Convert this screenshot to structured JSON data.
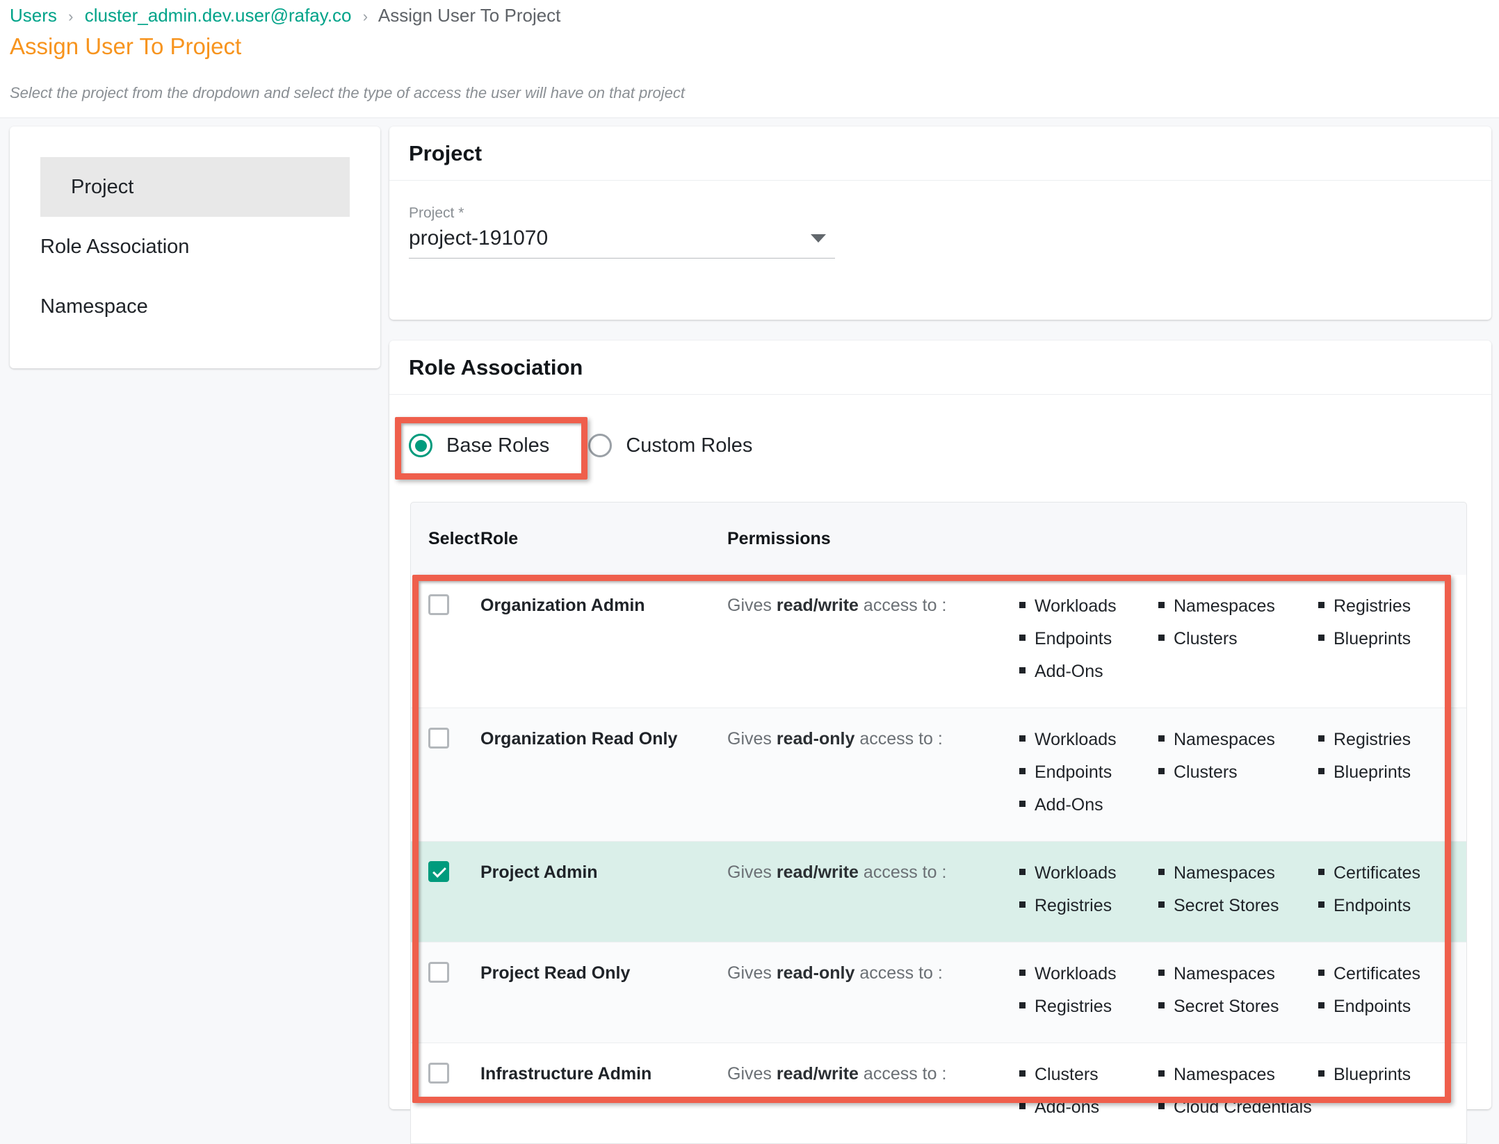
{
  "breadcrumb": {
    "items": [
      {
        "label": "Users",
        "type": "link"
      },
      {
        "label": "cluster_admin.dev.user@rafay.co",
        "type": "link"
      },
      {
        "label": "Assign User To Project",
        "type": "current"
      }
    ],
    "separator": "›"
  },
  "page": {
    "title": "Assign User To Project",
    "subtitle": "Select the project from the dropdown and select the type of access the user will have on that project",
    "title_color": "#f7941e"
  },
  "sidebar": {
    "items": [
      {
        "label": "Project",
        "active": true
      },
      {
        "label": "Role Association",
        "active": false
      },
      {
        "label": "Namespace",
        "active": false
      }
    ]
  },
  "project_card": {
    "heading": "Project",
    "field_label": "Project *",
    "selected_value": "project-191070"
  },
  "role_card": {
    "heading": "Role Association",
    "role_type_options": [
      {
        "label": "Base Roles",
        "selected": true
      },
      {
        "label": "Custom Roles",
        "selected": false
      }
    ],
    "table": {
      "headers": {
        "select": "Select",
        "role": "Role",
        "permissions": "Permissions"
      },
      "rows": [
        {
          "role": "Organization Admin",
          "desc_prefix": "Gives ",
          "desc_bold": "read/write",
          "desc_suffix": " access to :",
          "checked": false,
          "permission_columns": [
            [
              "Workloads",
              "Endpoints",
              "Add-Ons"
            ],
            [
              "Namespaces",
              "Clusters"
            ],
            [
              "Registries",
              "Blueprints"
            ]
          ]
        },
        {
          "role": "Organization Read Only",
          "desc_prefix": "Gives ",
          "desc_bold": "read-only",
          "desc_suffix": " access to :",
          "checked": false,
          "permission_columns": [
            [
              "Workloads",
              "Endpoints",
              "Add-Ons"
            ],
            [
              "Namespaces",
              "Clusters"
            ],
            [
              "Registries",
              "Blueprints"
            ]
          ]
        },
        {
          "role": "Project Admin",
          "desc_prefix": "Gives ",
          "desc_bold": "read/write",
          "desc_suffix": " access to :",
          "checked": true,
          "permission_columns": [
            [
              "Workloads",
              "Registries"
            ],
            [
              "Namespaces",
              "Secret Stores"
            ],
            [
              "Certificates",
              "Endpoints"
            ]
          ]
        },
        {
          "role": "Project Read Only",
          "desc_prefix": "Gives ",
          "desc_bold": "read-only",
          "desc_suffix": " access to :",
          "checked": false,
          "permission_columns": [
            [
              "Workloads",
              "Registries"
            ],
            [
              "Namespaces",
              "Secret Stores"
            ],
            [
              "Certificates",
              "Endpoints"
            ]
          ]
        },
        {
          "role": "Infrastructure Admin",
          "desc_prefix": "Gives ",
          "desc_bold": "read/write",
          "desc_suffix": " access to :",
          "checked": false,
          "permission_columns": [
            [
              "Clusters",
              "Add-ons"
            ],
            [
              "Namespaces",
              "Cloud Credentials"
            ],
            [
              "Blueprints"
            ]
          ]
        }
      ]
    }
  },
  "annotations": {
    "highlight_color": "#ef5f4c",
    "boxes": [
      {
        "target": "base-roles-radio"
      },
      {
        "target": "roles-table-body"
      }
    ]
  },
  "colors": {
    "accent_teal": "#009b7d",
    "brand_orange": "#f7941e",
    "selected_row_bg": "#daefe9"
  }
}
